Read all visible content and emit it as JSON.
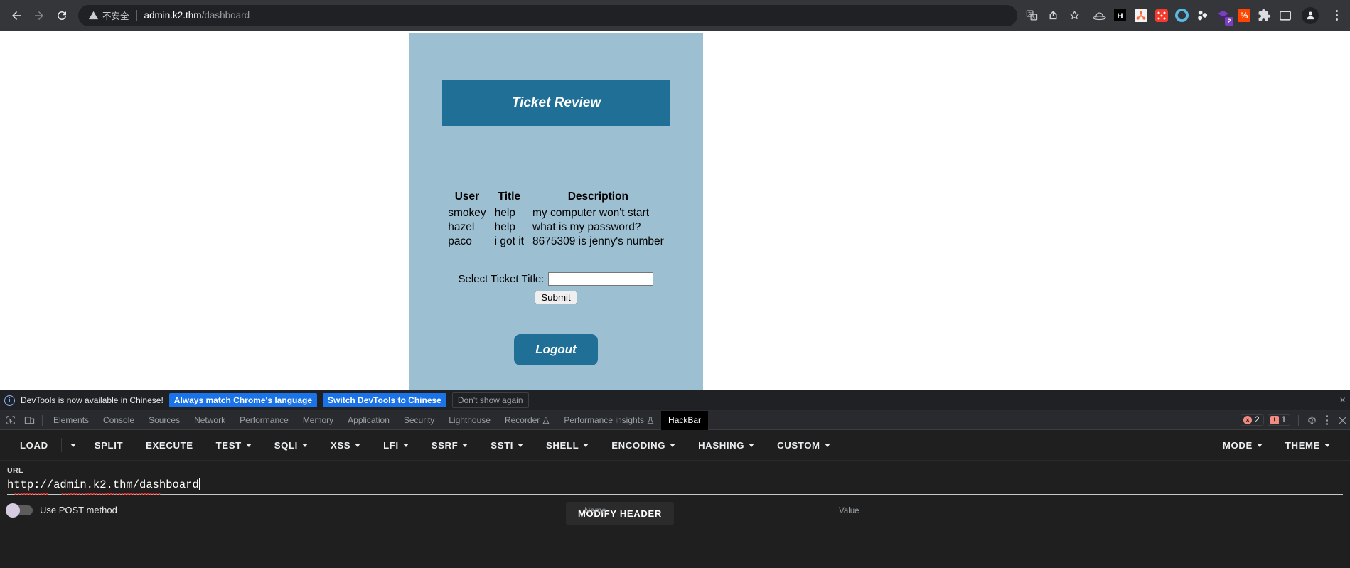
{
  "browser": {
    "back_label": "back-arrow",
    "forward_label": "forward-arrow",
    "reload_label": "reload",
    "security_text": "不安全",
    "url_host": "admin.k2.thm",
    "url_path": "/dashboard",
    "omnibox_icons": [
      "translate-icon",
      "share-icon",
      "bookmark-star-icon"
    ],
    "extensions": [
      {
        "name": "hat-icon",
        "label": "",
        "color": "#d0d2d6",
        "badge": ""
      },
      {
        "name": "hackbar-h-icon",
        "label": "H",
        "color": "#000000",
        "badge": ""
      },
      {
        "name": "burp-suite-icon",
        "label": "",
        "color": "#ff6633",
        "badge": ""
      },
      {
        "name": "dice-icon",
        "label": "",
        "color": "#f23a2e",
        "badge": ""
      },
      {
        "name": "circle-o-icon",
        "label": "",
        "color": "#5bb9e8",
        "badge": ""
      },
      {
        "name": "molecule-icon",
        "label": "",
        "color": "#e8e8e8",
        "badge": ""
      },
      {
        "name": "layers-icon",
        "label": "",
        "color": "#6f2da8",
        "badge": "2"
      },
      {
        "name": "percent-tag-icon",
        "label": "%",
        "color": "#ff4500",
        "badge": ""
      },
      {
        "name": "puzzle-extensions-icon",
        "label": "",
        "color": "#dadce0",
        "badge": ""
      },
      {
        "name": "sidepanel-icon",
        "label": "",
        "color": "#dadce0",
        "badge": ""
      }
    ]
  },
  "app": {
    "banner_title": "Ticket Review",
    "table": {
      "headers": [
        "User",
        "Title",
        "Description"
      ],
      "rows": [
        [
          "smokey",
          "help",
          "my computer won't start"
        ],
        [
          "hazel",
          "help",
          "what is my password?"
        ],
        [
          "paco",
          "i got it",
          "8675309 is jenny's number"
        ]
      ]
    },
    "form": {
      "label": "Select Ticket Title:",
      "input_value": "",
      "input_placeholder": "",
      "submit_label": "Submit"
    },
    "logout_label": "Logout",
    "colors": {
      "panel_bg": "#9cc0d2",
      "banner_bg": "#1f6f96",
      "button_bg": "#1f6f96"
    }
  },
  "devtools": {
    "notice": {
      "text": "DevTools is now available in Chinese!",
      "primary_btn": "Always match Chrome's language",
      "secondary_btn": "Switch DevTools to Chinese",
      "dismiss_btn": "Don't show again",
      "close_label": "×"
    },
    "tabs": [
      {
        "label": "Elements",
        "active": false,
        "beaker": false
      },
      {
        "label": "Console",
        "active": false,
        "beaker": false
      },
      {
        "label": "Sources",
        "active": false,
        "beaker": false
      },
      {
        "label": "Network",
        "active": false,
        "beaker": false
      },
      {
        "label": "Performance",
        "active": false,
        "beaker": false
      },
      {
        "label": "Memory",
        "active": false,
        "beaker": false
      },
      {
        "label": "Application",
        "active": false,
        "beaker": false
      },
      {
        "label": "Security",
        "active": false,
        "beaker": false
      },
      {
        "label": "Lighthouse",
        "active": false,
        "beaker": false
      },
      {
        "label": "Recorder",
        "active": false,
        "beaker": true
      },
      {
        "label": "Performance insights",
        "active": false,
        "beaker": true
      },
      {
        "label": "HackBar",
        "active": true,
        "beaker": false
      }
    ],
    "error_count": "2",
    "warning_count": "1"
  },
  "hackbar": {
    "buttons": [
      {
        "label": "LOAD",
        "caret": false
      },
      {
        "label": "",
        "caret": true,
        "caret_only": true
      },
      {
        "label": "SPLIT",
        "caret": false
      },
      {
        "label": "EXECUTE",
        "caret": false
      },
      {
        "label": "TEST",
        "caret": true
      },
      {
        "label": "SQLI",
        "caret": true
      },
      {
        "label": "XSS",
        "caret": true
      },
      {
        "label": "LFI",
        "caret": true
      },
      {
        "label": "SSRF",
        "caret": true
      },
      {
        "label": "SSTI",
        "caret": true
      },
      {
        "label": "SHELL",
        "caret": true
      },
      {
        "label": "ENCODING",
        "caret": true
      },
      {
        "label": "HASHING",
        "caret": true
      },
      {
        "label": "CUSTOM",
        "caret": true
      }
    ],
    "right_buttons": [
      {
        "label": "MODE",
        "caret": true
      },
      {
        "label": "THEME",
        "caret": true
      }
    ],
    "url_label": "URL",
    "url_value": "http://admin.k2.thm/dashboard",
    "post_toggle_label": "Use POST method",
    "post_toggle_on": false,
    "modify_header_label": "MODIFY HEADER",
    "header_table": {
      "name_col": "Name",
      "value_col": "Value"
    }
  }
}
